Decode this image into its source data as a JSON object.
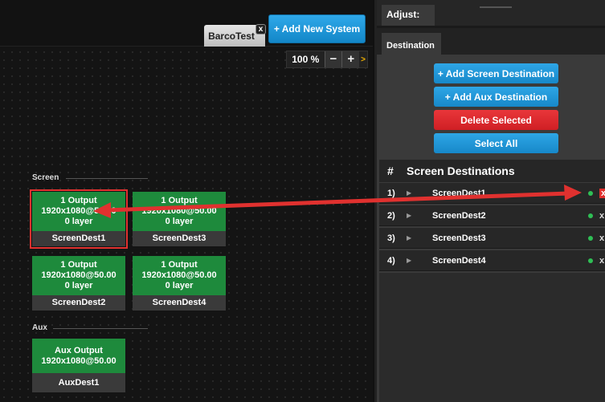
{
  "canvas": {
    "system_tab": "BarcoTest",
    "system_tab_close": "x",
    "add_system_label": "+ Add New System",
    "zoom_value": "100 %",
    "zoom_minus": "−",
    "zoom_plus": "+",
    "zoom_more": ">",
    "screen_section": "Screen",
    "aux_section": "Aux",
    "screen_tiles": [
      {
        "line1": "1 Output",
        "line2": "1920x1080@50.00",
        "line3": "0 layer",
        "name": "ScreenDest1",
        "selected": true
      },
      {
        "line1": "1 Output",
        "line2": "1920x1080@50.00",
        "line3": "0 layer",
        "name": "ScreenDest3",
        "selected": false
      },
      {
        "line1": "1 Output",
        "line2": "1920x1080@50.00",
        "line3": "0 layer",
        "name": "ScreenDest2",
        "selected": false
      },
      {
        "line1": "1 Output",
        "line2": "1920x1080@50.00",
        "line3": "0 layer",
        "name": "ScreenDest4",
        "selected": false
      }
    ],
    "aux_tiles": [
      {
        "line1": "Aux Output",
        "line2": "1920x1080@50.00",
        "name": "AuxDest1"
      }
    ]
  },
  "panel": {
    "adjust_tab": "Adjust:",
    "destination_tab": "Destination",
    "buttons": {
      "add_screen": "+ Add Screen Destination",
      "add_aux": "+ Add Aux Destination",
      "delete_selected": "Delete Selected",
      "select_all": "Select All"
    },
    "list_header_hash": "#",
    "list_header_title": "Screen Destinations",
    "rows": [
      {
        "num": "1)",
        "name": "ScreenDest1",
        "x": "x"
      },
      {
        "num": "2)",
        "name": "ScreenDest2",
        "x": "x"
      },
      {
        "num": "3)",
        "name": "ScreenDest3",
        "x": "x"
      },
      {
        "num": "4)",
        "name": "ScreenDest4",
        "x": "x"
      }
    ]
  },
  "colors": {
    "tile_green": "#1e8a3c",
    "accent_blue": "#1e98da",
    "delete_red": "#e0312f",
    "annotation_arrow": "#e0312f"
  }
}
